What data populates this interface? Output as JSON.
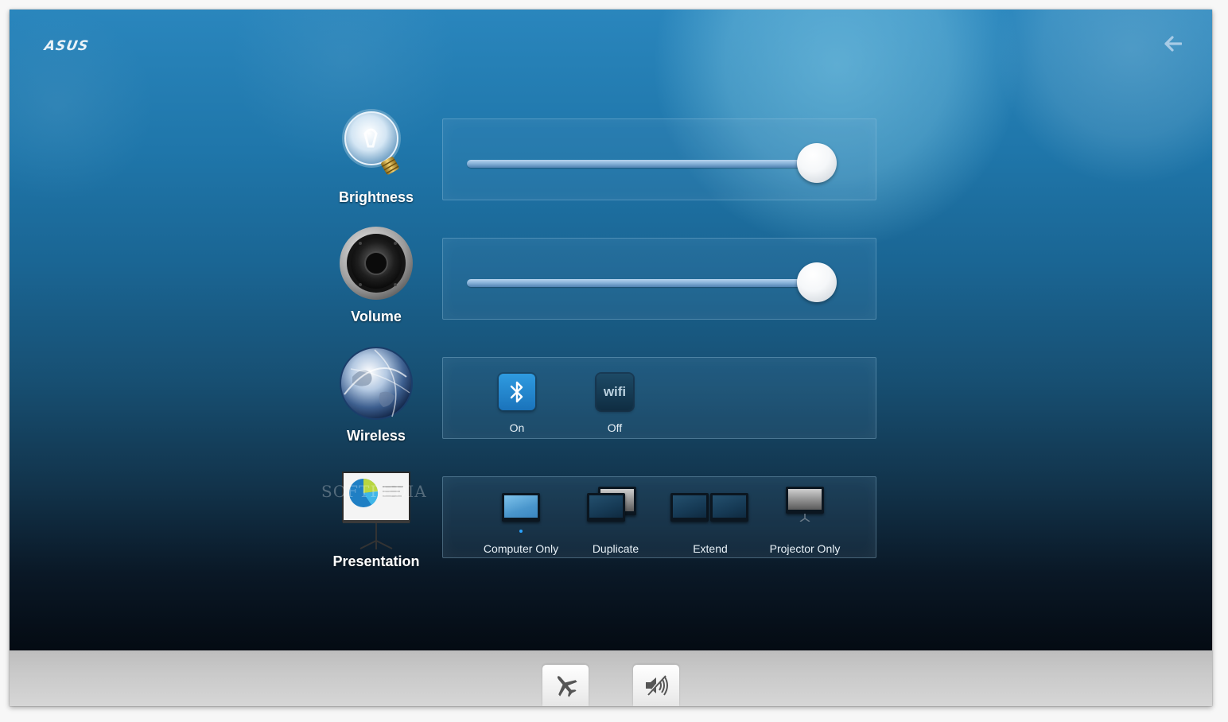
{
  "app": {
    "logo_text": "ASUS",
    "back_icon": "arrow-left-icon"
  },
  "colors": {
    "background_top": "#2a86bd",
    "background_bottom": "#040b13",
    "bluetooth_on": "#1a73bb",
    "wifi_off": "#0f2d42",
    "bottom_bar": "#c9c9c9"
  },
  "features": {
    "brightness": {
      "label": "Brightness",
      "icon": "light-bulb-icon",
      "slider_value_percent": 100
    },
    "volume": {
      "label": "Volume",
      "icon": "speaker-icon",
      "slider_value_percent": 100
    },
    "wireless": {
      "label": "Wireless",
      "icon": "globe-icon",
      "toggles": [
        {
          "name": "Bluetooth",
          "icon": "bluetooth-icon",
          "state": "On"
        },
        {
          "name": "WiFi",
          "icon": "wifi-icon",
          "icon_text": "wifi",
          "state": "Off"
        }
      ]
    },
    "presentation": {
      "label": "Presentation",
      "icon": "projector-screen-icon",
      "modes": [
        {
          "label": "Computer Only",
          "icon": "computer-only-icon",
          "selected": true
        },
        {
          "label": "Duplicate",
          "icon": "duplicate-icon",
          "selected": false
        },
        {
          "label": "Extend",
          "icon": "extend-icon",
          "selected": false
        },
        {
          "label": "Projector Only",
          "icon": "projector-only-icon",
          "selected": false
        }
      ]
    }
  },
  "bottom_bar": {
    "buttons": [
      {
        "name": "Airplane mode",
        "icon": "airplane-icon"
      },
      {
        "name": "Mute",
        "icon": "mute-speaker-icon"
      }
    ]
  },
  "watermark": "SOFTPEDIA"
}
